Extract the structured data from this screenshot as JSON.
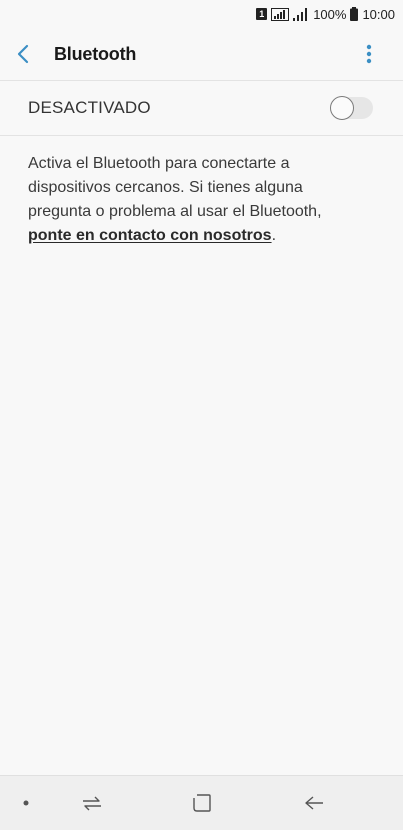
{
  "status_bar": {
    "sim": "1",
    "battery": "100%",
    "time": "10:00"
  },
  "header": {
    "title": "Bluetooth"
  },
  "bluetooth_toggle": {
    "label": "DESACTIVADO",
    "enabled": false
  },
  "description": {
    "text": "Activa el Bluetooth para conectarte a dispositivos cercanos. Si tienes alguna pregunta o problema al usar el Bluetooth, ",
    "link": "ponte en contacto con nosotros",
    "suffix": "."
  },
  "colors": {
    "accent": "#3b8fc4",
    "background": "#f8f8f8",
    "nav_background": "#efefef"
  },
  "icons": {
    "back": "chevron-left-icon",
    "more": "more-vertical-icon",
    "nav_dot": "nav-dot-icon",
    "nav_recents": "recents-icon",
    "nav_home": "home-icon",
    "nav_back": "nav-back-icon"
  }
}
